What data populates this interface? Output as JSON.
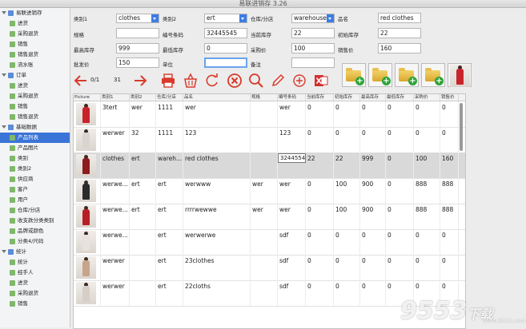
{
  "window": {
    "title": "易联进销存 3.26"
  },
  "sidebar": {
    "rows": [
      {
        "type": "cat",
        "label": "易联进销存"
      },
      {
        "type": "item",
        "label": "进货"
      },
      {
        "type": "item",
        "label": "采购退货"
      },
      {
        "type": "item",
        "label": "销售"
      },
      {
        "type": "item",
        "label": "销售退货"
      },
      {
        "type": "item",
        "label": "流水账"
      },
      {
        "type": "cat",
        "label": "订单"
      },
      {
        "type": "item",
        "label": "进货"
      },
      {
        "type": "item",
        "label": "采购退货"
      },
      {
        "type": "item",
        "label": "销售"
      },
      {
        "type": "item",
        "label": "销售退货"
      },
      {
        "type": "cat",
        "label": "基础数据"
      },
      {
        "type": "item",
        "label": "产品列表",
        "selected": true
      },
      {
        "type": "item",
        "label": "产品图片"
      },
      {
        "type": "item",
        "label": "类别"
      },
      {
        "type": "item",
        "label": "类别2"
      },
      {
        "type": "item",
        "label": "供应商"
      },
      {
        "type": "item",
        "label": "客户"
      },
      {
        "type": "item",
        "label": "用户"
      },
      {
        "type": "item",
        "label": "仓库/分店"
      },
      {
        "type": "item",
        "label": "收支款分类类别"
      },
      {
        "type": "item",
        "label": "品牌或颜色"
      },
      {
        "type": "item",
        "label": "分类4/尺码"
      },
      {
        "type": "cat",
        "label": "统计"
      },
      {
        "type": "item",
        "label": "统计"
      },
      {
        "type": "item",
        "label": "经手人"
      },
      {
        "type": "item",
        "label": "进货"
      },
      {
        "type": "item",
        "label": "采购退货"
      },
      {
        "type": "item",
        "label": "销售"
      }
    ]
  },
  "form": {
    "category1_label": "类别1",
    "category1_value": "clothes",
    "category2_label": "类别2",
    "category2_value": "ert",
    "warehouse_label": "仓库/分店",
    "warehouse_value": "warehouse",
    "name_label": "品名",
    "name_value": "red clothes",
    "spec_label": "规格",
    "spec_value": "",
    "barcode_label": "编号条码",
    "barcode_value": "32445545",
    "current_stock_label": "当前库存",
    "current_stock_value": "22",
    "initial_stock_label": "初始库存",
    "initial_stock_value": "22",
    "max_stock_label": "最高库存",
    "max_stock_value": "999",
    "min_stock_label": "最低库存",
    "min_stock_value": "0",
    "purchase_price_label": "采购价",
    "purchase_price_value": "100",
    "sale_price_label": "销售价",
    "sale_price_value": "160",
    "wholesale_label": "批发价",
    "wholesale_value": "150",
    "unit_label": "单位",
    "unit_value": "",
    "note_label": "备注",
    "note_value": ""
  },
  "toolbar": {
    "record_position": "0/1",
    "record_total": "31",
    "icons": [
      "back-arrow-icon",
      "forward-arrow-icon",
      "printer-icon",
      "delete-basket-icon",
      "refresh-icon",
      "cancel-icon",
      "search-icon",
      "edit-pencil-icon",
      "add-icon",
      "excel-export-icon"
    ]
  },
  "table": {
    "headers": [
      "Picture",
      "类别1",
      "类别2",
      "仓库/分店",
      "品名",
      "规格",
      "编号条码",
      "当前库存",
      "初始库存",
      "最高库存",
      "最低库存",
      "采购价",
      "销售价"
    ],
    "rows": [
      {
        "cells": [
          "3tert",
          "wer",
          "1111",
          "wer",
          "",
          "wer",
          "0",
          "0",
          "0",
          "0",
          "0",
          "0"
        ]
      },
      {
        "cells": [
          "werwer",
          "32",
          "1111",
          "123",
          "",
          "123",
          "0",
          "0",
          "0",
          "0",
          "0",
          "0"
        ]
      },
      {
        "cells": [
          "clothes",
          "ert",
          "wareh...",
          "red clothes",
          "",
          "32445545",
          "22",
          "22",
          "999",
          "0",
          "100",
          "160"
        ],
        "selected": true
      },
      {
        "cells": [
          "werwe...",
          "ert",
          "ert",
          "werwww",
          "wer",
          "wer",
          "0",
          "100",
          "900",
          "0",
          "888",
          "888"
        ]
      },
      {
        "cells": [
          "werwe...",
          "ert",
          "ert",
          "rrrrwewwe",
          "wer",
          "wer",
          "0",
          "100",
          "900",
          "0",
          "888",
          "888"
        ]
      },
      {
        "cells": [
          "werwe...",
          "",
          "ert",
          "werwerwe",
          "",
          "sdf",
          "0",
          "0",
          "0",
          "0",
          "0",
          "0"
        ]
      },
      {
        "cells": [
          "werwer",
          "",
          "ert",
          "23clothes",
          "",
          "sdf",
          "0",
          "0",
          "0",
          "0",
          "0",
          "0"
        ]
      },
      {
        "cells": [
          "werwer",
          "",
          "ert",
          "22cloths",
          "",
          "sdf",
          "0",
          "0",
          "0",
          "0",
          "0",
          "0"
        ]
      }
    ]
  },
  "watermark": {
    "main": "9553",
    "sub": "下载",
    "url": "www.9553.com"
  },
  "colors": {
    "accent": "#3b74d7",
    "toolbar_red": "#d93a2b",
    "excel": "#d32f2f",
    "folder": "#e8c051",
    "plus": "#2fa43a"
  }
}
